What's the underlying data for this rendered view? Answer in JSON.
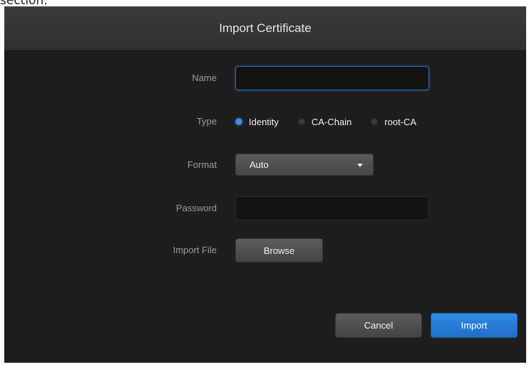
{
  "page_fragment_text": "section.",
  "dialog": {
    "title": "Import Certificate",
    "fields": {
      "name": {
        "label": "Name",
        "value": "",
        "placeholder": ""
      },
      "type": {
        "label": "Type",
        "options": [
          "Identity",
          "CA-Chain",
          "root-CA"
        ],
        "selected": "Identity"
      },
      "format": {
        "label": "Format",
        "selected": "Auto"
      },
      "password": {
        "label": "Password",
        "value": "",
        "placeholder": ""
      },
      "import_file": {
        "label": "Import File",
        "button_label": "Browse"
      }
    },
    "buttons": {
      "cancel": "Cancel",
      "import": "Import"
    }
  },
  "colors": {
    "dialog_background": "#1e1e1e",
    "header_background": "#333333",
    "accent": "#2a7fd9",
    "radio_checked": "#3a8ee6"
  },
  "icons": {
    "format_dropdown": "caret-down-icon"
  }
}
